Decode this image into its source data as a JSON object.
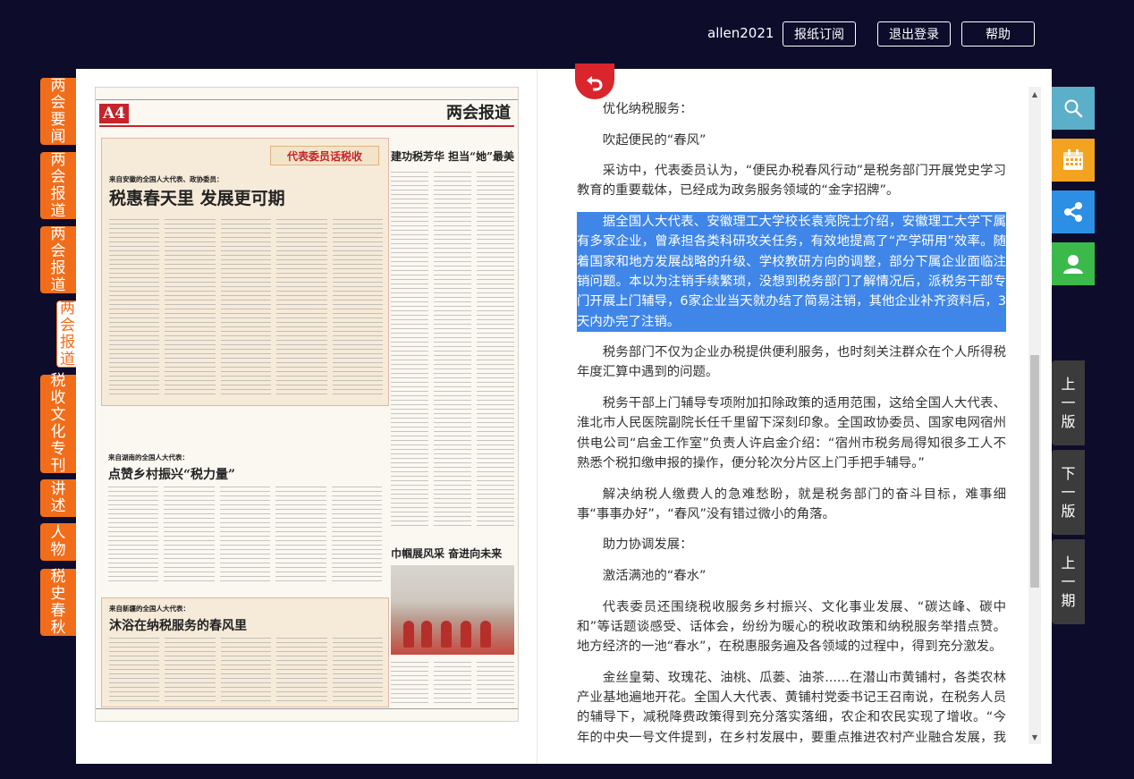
{
  "header": {
    "username": "allen2021",
    "buttons": {
      "subscribe": "报纸订阅",
      "logout": "退出登录",
      "help": "帮助"
    }
  },
  "sections": [
    {
      "label": "两会要闻"
    },
    {
      "label": "两会报道"
    },
    {
      "label": "两会报道"
    },
    {
      "label": "两会报道"
    },
    {
      "label": "税收文化专刊"
    },
    {
      "label": "讲述"
    },
    {
      "label": "人物"
    },
    {
      "label": "税史春秋"
    }
  ],
  "newspaper": {
    "page_no": "A4",
    "section_title": "两会报道",
    "banner": "代表委员话税收",
    "stories": [
      {
        "kicker": "来自安徽的全国人大代表、政协委员：",
        "headline": "税惠春天里 发展更可期"
      },
      {
        "kicker": "来自湖南的全国人大代表：",
        "headline": "点赞乡村振兴“税力量”"
      },
      {
        "kicker": "来自新疆的全国人大代表：",
        "headline": "沐浴在纳税服务的春风里"
      },
      {
        "kicker": "",
        "headline": "建功税芳华 担当“她”最美"
      },
      {
        "kicker": "",
        "headline": "巾帼展风采 奋进向未来"
      }
    ]
  },
  "article": {
    "paragraphs": [
      "优化纳税服务：",
      "吹起便民的“春风”",
      "采访中，代表委员认为，“便民办税春风行动”是税务部门开展党史学习教育的重要载体，已经成为政务服务领域的“金字招牌”。",
      "据全国人大代表、安徽理工大学校长袁亮院士介绍，安徽理工大学下属有多家企业，曾承担各类科研攻关任务，有效地提高了“产学研用”效率。随着国家和地方发展战略的升级、学校教研方向的调整，部分下属企业面临注销问题。本以为注销手续繁琐，没想到税务部门了解情况后，派税务干部专门开展上门辅导，6家企业当天就办结了简易注销，其他企业补齐资料后，3天内办完了注销。",
      "税务部门不仅为企业办税提供便利服务，也时刻关注群众在个人所得税年度汇算中遇到的问题。",
      "税务干部上门辅导专项附加扣除政策的适用范围，这给全国人大代表、淮北市人民医院副院长任千里留下深刻印象。全国政协委员、国家电网宿州供电公司“启金工作室”负责人许启金介绍：“宿州市税务局得知很多工人不熟悉个税扣缴申报的操作，便分轮次分片区上门手把手辅导。”",
      "解决纳税人缴费人的急难愁盼，就是税务部门的奋斗目标，难事细事“事事办好”，“春风”没有错过微小的角落。",
      "助力协调发展：",
      "激活满池的“春水”",
      "代表委员还围绕税收服务乡村振兴、文化事业发展、“碳达峰、碳中和”等话题谈感受、话体会，纷纷为暖心的税收政策和纳税服务举措点赞。地方经济的一池“春水”，在税惠服务遍及各领域的过程中，得到充分激发。",
      "金丝皇菊、玫瑰花、油桃、瓜蒌、油茶......在潜山市黄铺村，各类农林产业基地遍地开花。全国人大代表、黄铺村党委书记王召南说，在税务人员的辅导下，减税降费政策得到充分落实落细，农企和农民实现了增收。“今年的中央一号文件提到，在乡村发展中，要重点推进农村产业融合发展，我们合作社就是要朝着这个目标迈进。”"
    ]
  },
  "nav": {
    "prev_page": "上一版",
    "next_page": "下一版",
    "prev_issue": "上一期"
  },
  "colors": {
    "background": "#0d0c2b",
    "section_tab": "#f26d1a",
    "highlight": "#3f86e8",
    "search": "#5bafc8",
    "calendar": "#f4a321",
    "share": "#2d8fe3",
    "user": "#3cb94b",
    "nav": "#3b3b3b",
    "back": "#d9252b"
  },
  "icons": {
    "search": "search-icon",
    "calendar": "calendar-icon",
    "share": "share-icon",
    "user": "user-icon",
    "back": "back-arrow-icon"
  }
}
